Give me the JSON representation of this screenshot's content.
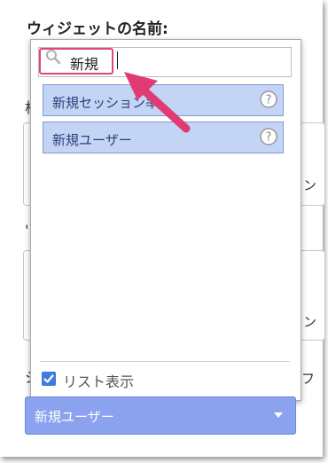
{
  "widget": {
    "name_label": "ウィジェットの名前:"
  },
  "background": {
    "frag_left_1": "相",
    "frag_left_2": "'",
    "frag_left_3": "ジ",
    "frag_right_1": "ン",
    "frag_right_2": "ン",
    "frag_right_3": "フ"
  },
  "search": {
    "value": "新規",
    "icon": "search-icon"
  },
  "options": [
    {
      "label": "新規セッション率",
      "icon": "help-icon"
    },
    {
      "label": "新規ユーザー",
      "icon": "help-icon"
    }
  ],
  "list_display": {
    "label": "リスト表示",
    "checked": true
  },
  "select": {
    "value": "新規ユーザー"
  },
  "colors": {
    "highlight": "#e0457b",
    "option_bg": "#c4d4f5",
    "select_bg": "#8ba3ee",
    "arrow": "#e23a72"
  }
}
